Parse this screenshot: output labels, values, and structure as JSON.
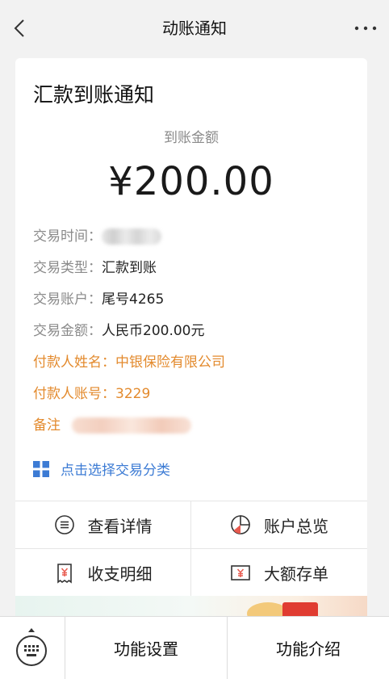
{
  "nav": {
    "title": "动账通知",
    "back_icon": "chevron-left-icon",
    "more_icon": "more-horizontal-icon"
  },
  "notice": {
    "title": "汇款到账通知",
    "amount_label": "到账金额",
    "amount": "¥200.00",
    "rows": [
      {
        "label": "交易时间：",
        "value": ""
      },
      {
        "label": "交易类型：",
        "value": "汇款到账"
      },
      {
        "label": "交易账户：",
        "value": "尾号4265"
      },
      {
        "label": "交易金额：",
        "value": "人民币200.00元"
      },
      {
        "label": "付款人姓名：",
        "value": "中银保险有限公司"
      },
      {
        "label": "付款人账号：",
        "value": "3229"
      },
      {
        "label": "备注",
        "value": ""
      }
    ],
    "highlight_color": "#e38a2d",
    "category_link": "点击选择交易分类",
    "link_color": "#3c7bd4"
  },
  "menu": {
    "items": [
      {
        "label": "查看详情",
        "icon": "list-circle-icon"
      },
      {
        "label": "账户总览",
        "icon": "pie-chart-icon"
      },
      {
        "label": "收支明细",
        "icon": "receipt-yen-icon"
      },
      {
        "label": "大额存单",
        "icon": "certificate-yen-icon"
      }
    ]
  },
  "bottom_bar": {
    "keyboard_icon": "keyboard-icon",
    "buttons": [
      "功能设置",
      "功能介绍"
    ]
  }
}
